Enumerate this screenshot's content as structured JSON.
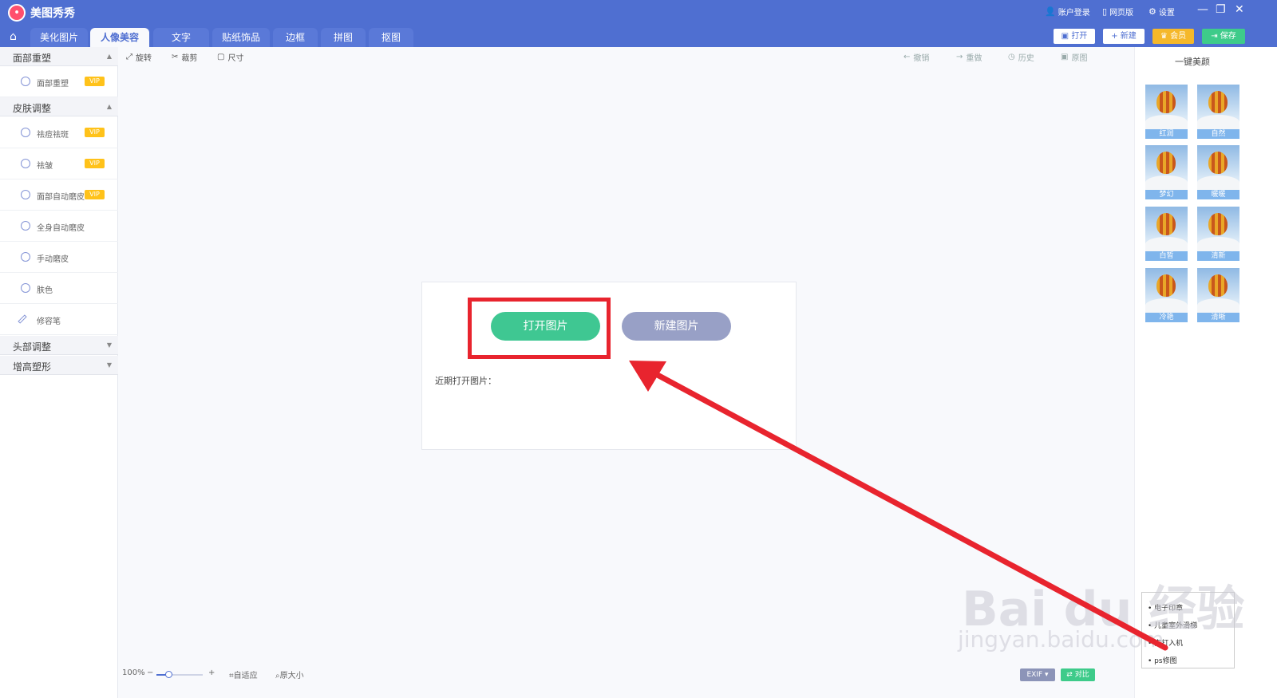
{
  "app": {
    "name": "美图秀秀",
    "logo": "ꔷ"
  },
  "topbar": {
    "account": "账户登录",
    "web": "网页版",
    "settings": "设置",
    "min": "—",
    "max": "❐",
    "close": "✕"
  },
  "tabs": [
    "美化图片",
    "人像美容",
    "文字",
    "贴纸饰品",
    "边框",
    "拼图",
    "抠图"
  ],
  "actions": {
    "open": "打开",
    "new": "新建",
    "vip": "会员",
    "save": "保存"
  },
  "sidebar": {
    "sections": [
      {
        "label": "面部重塑"
      },
      {
        "label": "皮肤调整"
      },
      {
        "label": "头部调整"
      },
      {
        "label": "增高塑形"
      }
    ],
    "items": [
      {
        "label": "面部重塑",
        "vip": "VIP"
      },
      {
        "label": "祛痘祛斑",
        "vip": "VIP"
      },
      {
        "label": "祛皱",
        "vip": "VIP"
      },
      {
        "label": "面部自动磨皮",
        "vip": "VIP"
      },
      {
        "label": "全身自动磨皮"
      },
      {
        "label": "手动磨皮"
      },
      {
        "label": "肤色"
      },
      {
        "label": "修容笔"
      }
    ]
  },
  "toolbar": {
    "rotate": "旋转",
    "crop": "裁剪",
    "size": "尺寸",
    "undo": "撤销",
    "redo": "重做",
    "history": "历史",
    "original": "原图"
  },
  "rightpanel": {
    "title": "一键美颜",
    "filters": [
      "红润",
      "自然",
      "梦幻",
      "暖暖",
      "白皙",
      "清新",
      "冷艳",
      "清晰"
    ]
  },
  "center": {
    "open_image": "打开图片",
    "new_image": "新建图片",
    "recent": "近期打开图片："
  },
  "bottom": {
    "zoom": "100%",
    "fit": "自适应",
    "orig_size": "原大小",
    "exif": "EXIF ▾",
    "compare": "对比"
  },
  "popup": {
    "items": [
      "电子印章",
      "儿童室外滑梯",
      "安打入机",
      "ps修图"
    ]
  },
  "watermark": {
    "brand": "Bai du 经验",
    "url": "jingyan.baidu.com"
  },
  "colors": {
    "header": "#4f6fd1",
    "open_btn": "#3fc792",
    "new_btn": "#98a0c6",
    "highlight": "#e8242e",
    "vip": "#ffc21a"
  }
}
